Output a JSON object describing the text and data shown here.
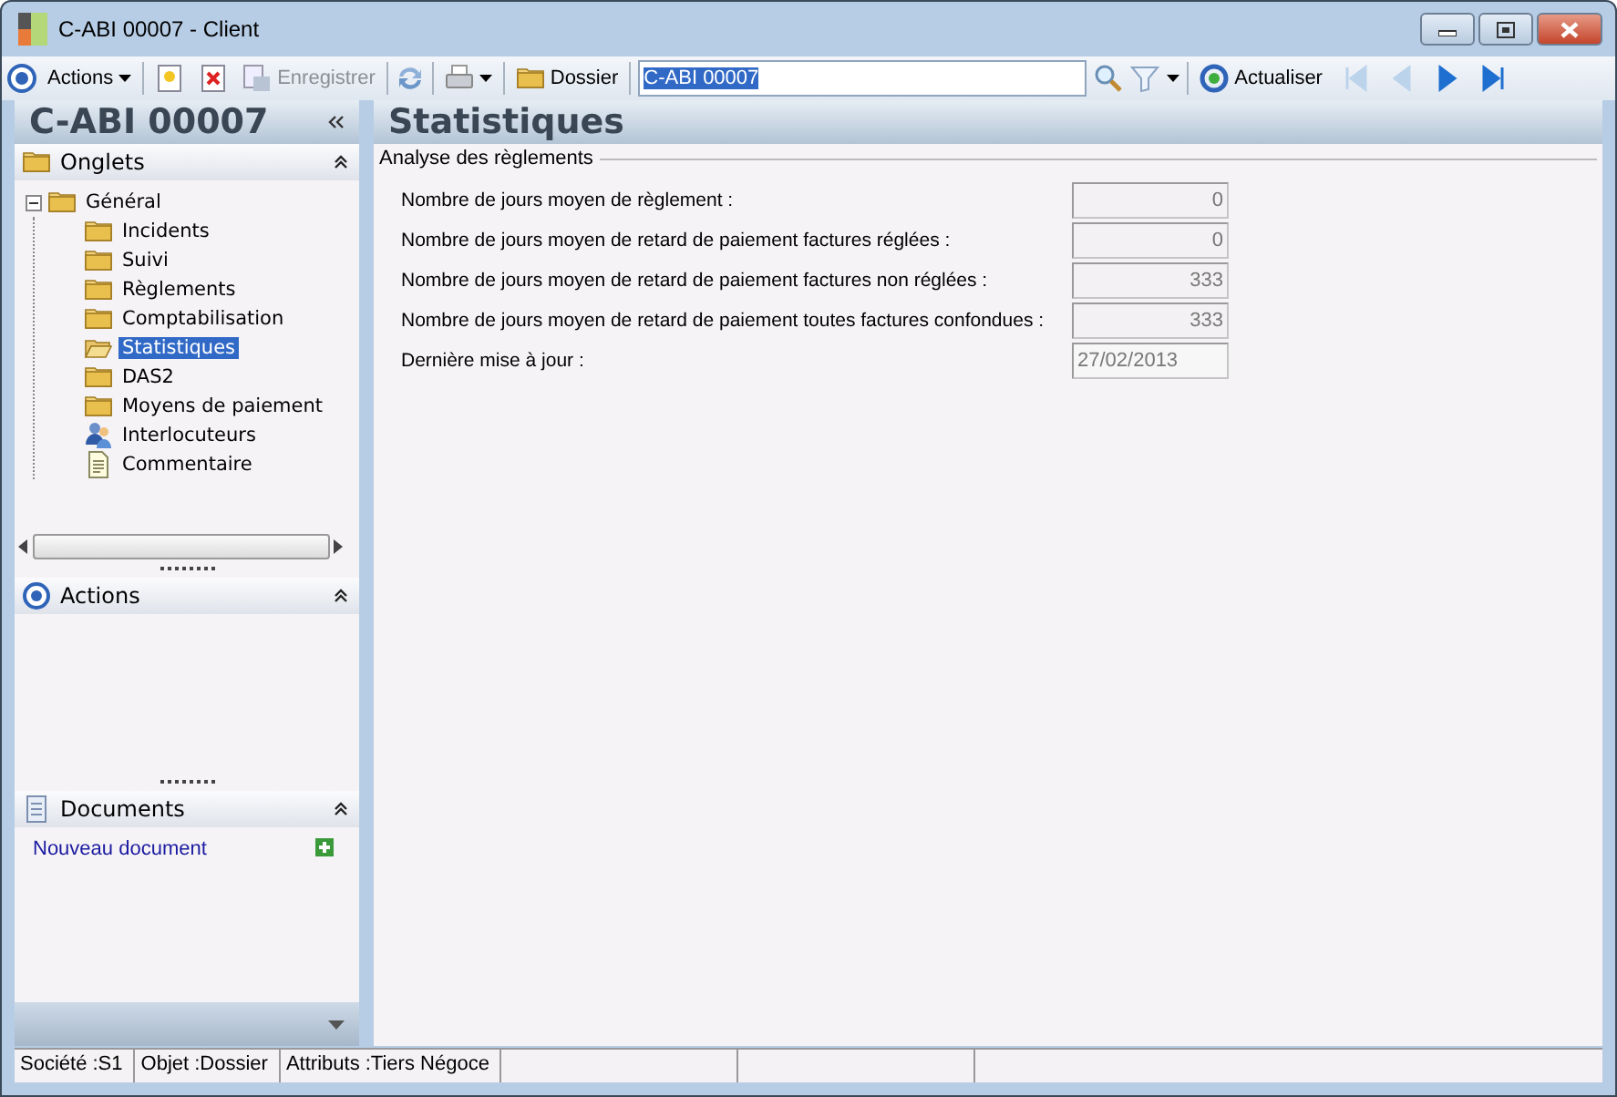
{
  "window": {
    "title": "C-ABI 00007 -  Client"
  },
  "toolbar": {
    "actions_label": "Actions",
    "save_label": "Enregistrer",
    "save_disabled": true,
    "folder_label": "Dossier",
    "search_value": "C-ABI 00007",
    "refresh_label": "Actualiser",
    "nav": [
      {
        "kind": "first",
        "disabled": true
      },
      {
        "kind": "previous",
        "disabled": true
      },
      {
        "kind": "next",
        "disabled": false
      },
      {
        "kind": "last",
        "disabled": false
      }
    ]
  },
  "sidebar": {
    "title": "C-ABI 00007",
    "tabs_section": {
      "title": "Onglets",
      "tree": [
        {
          "label": "Général",
          "kind": "folder",
          "expanded": true,
          "selected": false,
          "children": [
            {
              "label": "Incidents",
              "kind": "folder",
              "selected": false
            },
            {
              "label": "Suivi",
              "kind": "folder",
              "selected": false
            },
            {
              "label": "Règlements",
              "kind": "folder",
              "selected": false
            },
            {
              "label": "Comptabilisation",
              "kind": "folder",
              "selected": false
            },
            {
              "label": "Statistiques",
              "kind": "folder",
              "selected": true
            },
            {
              "label": "DAS2",
              "kind": "folder",
              "selected": false
            },
            {
              "label": "Moyens de paiement",
              "kind": "folder",
              "selected": false
            },
            {
              "label": "Interlocuteurs",
              "kind": "contacts",
              "selected": false
            },
            {
              "label": "Commentaire",
              "kind": "note",
              "selected": false
            }
          ]
        }
      ]
    },
    "actions_section": {
      "title": "Actions"
    },
    "documents_section": {
      "title": "Documents",
      "link": "Nouveau document"
    }
  },
  "main": {
    "title": "Statistiques",
    "group": "Analyse des règlements",
    "fields": [
      {
        "label": "Nombre de jours moyen de règlement :",
        "value": "0",
        "kind": "number"
      },
      {
        "label": "Nombre de jours moyen de retard de paiement factures réglées :",
        "value": "0",
        "kind": "number"
      },
      {
        "label": "Nombre de jours moyen de retard de paiement factures non réglées :",
        "value": "333",
        "kind": "number"
      },
      {
        "label": "Nombre de jours moyen de retard de paiement toutes factures confondues :",
        "value": "333",
        "kind": "number"
      },
      {
        "label": "Dernière mise à jour :",
        "value": "27/02/2013",
        "kind": "date"
      }
    ]
  },
  "status_bar": [
    "Société :S1",
    "Objet :Dossier",
    "Attributs :Tiers Négoce"
  ]
}
